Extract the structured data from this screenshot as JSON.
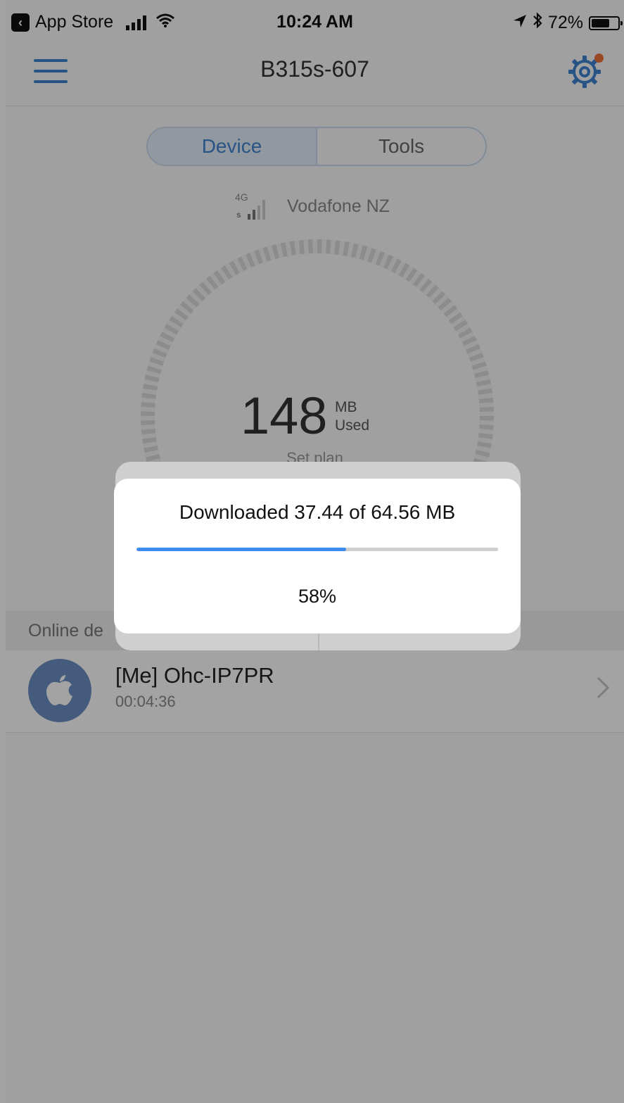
{
  "status_bar": {
    "back_app": "App Store",
    "time": "10:24 AM",
    "battery": "72%",
    "battery_level": 0.72,
    "icons": [
      "back-icon",
      "signal-bars-icon",
      "wifi-icon",
      "location-arrow-icon",
      "bluetooth-icon",
      "battery-icon"
    ]
  },
  "header": {
    "title": "B315s-607",
    "icons": [
      "hamburger-menu-icon",
      "settings-gear-icon"
    ],
    "gear_color": "#3f84d0",
    "notification_dot_color": "#f0753a"
  },
  "tabs": [
    {
      "label": "Device",
      "selected": true
    },
    {
      "label": "Tools",
      "selected": false
    }
  ],
  "network": {
    "badge_top": "4G",
    "badge_bottom": "s",
    "carrier": "Vodafone NZ",
    "signal_bars": 2,
    "signal_bars_total": 4
  },
  "usage": {
    "value": "148",
    "unit": "MB",
    "unit_label": "Used",
    "plan_link": "Set plan"
  },
  "online_devices": {
    "title": "Online de",
    "items": [
      {
        "name": "[Me] Ohc-IP7PR",
        "duration": "00:04:36",
        "icon": "apple-logo-icon"
      }
    ]
  },
  "dialog": {
    "message": "Downloaded 37.44 of 64.56 MB",
    "percent_label": "58%",
    "progress": 0.58,
    "accent": "#3f8cf0"
  }
}
